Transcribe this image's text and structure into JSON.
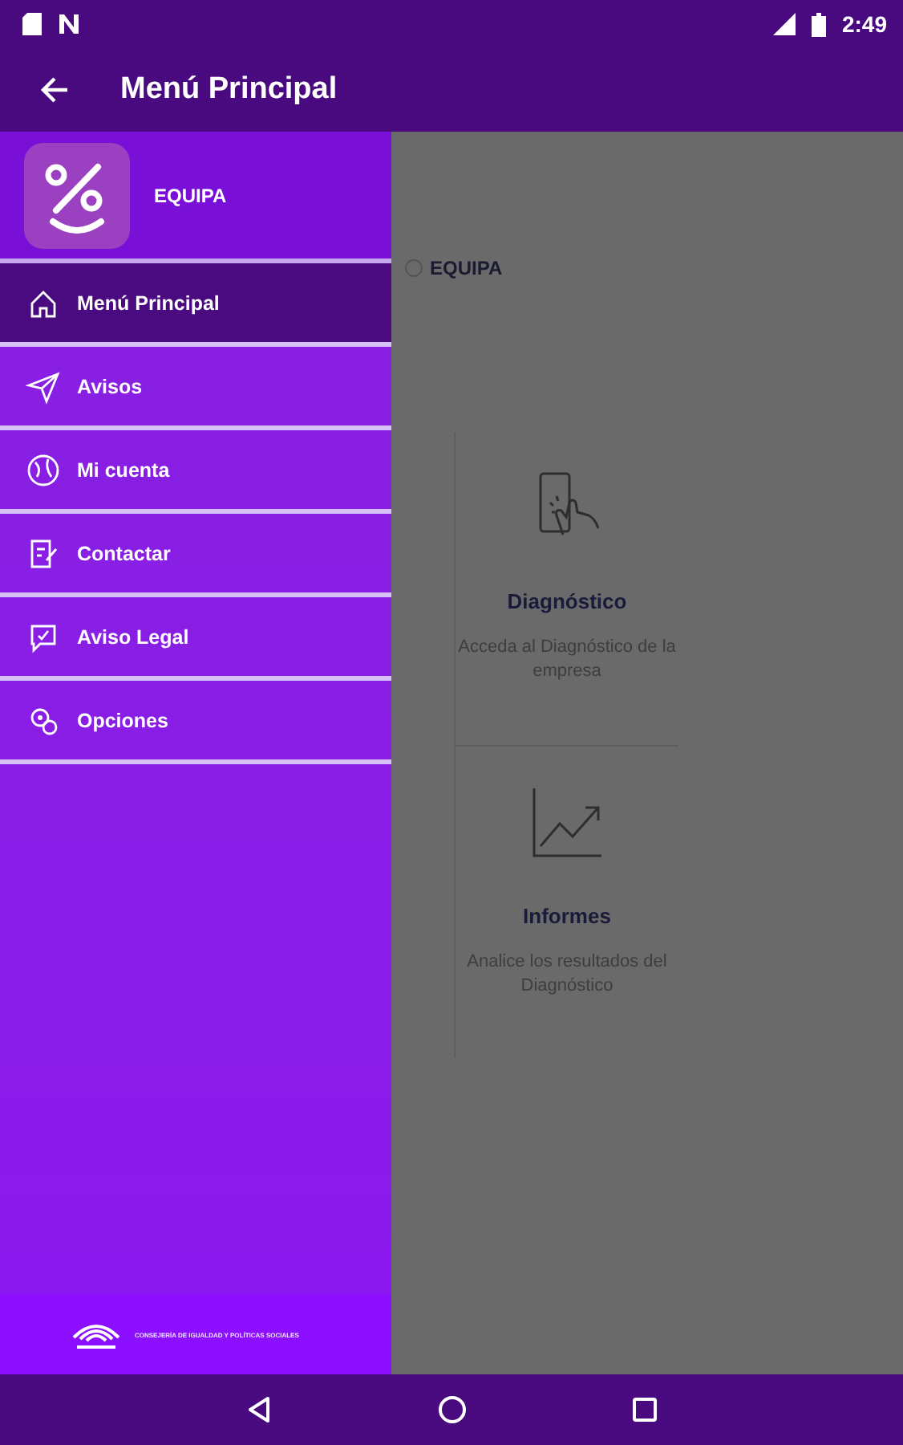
{
  "status_bar": {
    "time": "2:49"
  },
  "app_bar": {
    "title": "Menú Principal"
  },
  "drawer": {
    "header": {
      "app_name": "EQUIPA"
    },
    "items": [
      {
        "label": "Menú Principal",
        "selected": true
      },
      {
        "label": "Avisos",
        "selected": false
      },
      {
        "label": "Mi cuenta",
        "selected": false
      },
      {
        "label": "Contactar",
        "selected": false
      },
      {
        "label": "Aviso Legal",
        "selected": false
      },
      {
        "label": "Opciones",
        "selected": false
      }
    ],
    "footer": {
      "text": "CONSEJERÍA DE IGUALDAD Y POLÍTICAS SOCIALES"
    }
  },
  "background": {
    "section_label": "EQUIPA",
    "cards": [
      {
        "kind": "diagnostic",
        "title": "Diagnóstico",
        "description": "Acceda al Diagnóstico de la empresa"
      },
      {
        "kind": "reports",
        "title": "Informes",
        "description": "Analice los resultados del Diagnóstico"
      }
    ]
  }
}
